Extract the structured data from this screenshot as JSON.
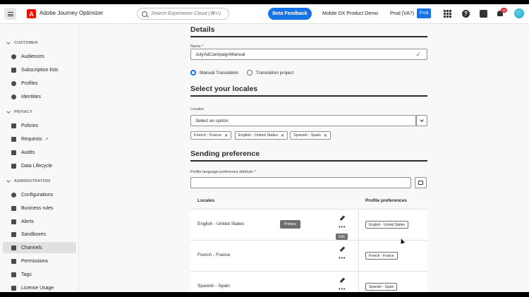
{
  "header": {
    "logo_letter": "A",
    "app_name": "Adobe Journey Optimizer",
    "search_placeholder": "Search Experience Cloud (⌘+/)",
    "beta_label": "Beta Feedback",
    "org_name": "Mobile DX Product Demo",
    "sandbox_name": "Prod (VA7)",
    "sandbox_badge": "Prod",
    "help_glyph": "?",
    "notification_count": "16",
    "icons": [
      "menu-icon",
      "apps-icon",
      "help-icon",
      "chat-icon",
      "bell-icon",
      "avatar"
    ],
    "accent_color": "#1473e6"
  },
  "sidebar": {
    "sections": [
      {
        "title": "CUSTOMER",
        "items": [
          {
            "label": "Audiences",
            "icon": "audiences-icon"
          },
          {
            "label": "Subscription lists",
            "icon": "subscription-lists-icon"
          },
          {
            "label": "Profiles",
            "icon": "profiles-icon"
          },
          {
            "label": "Identities",
            "icon": "identities-icon"
          }
        ]
      },
      {
        "title": "PRIVACY",
        "items": [
          {
            "label": "Policies",
            "icon": "policies-icon"
          },
          {
            "label": "Requests",
            "icon": "requests-icon",
            "ext": "↗"
          },
          {
            "label": "Audits",
            "icon": "audits-icon"
          },
          {
            "label": "Data Lifecycle",
            "icon": "data-lifecycle-icon"
          }
        ]
      },
      {
        "title": "ADMINISTRATION",
        "items": [
          {
            "label": "Configurations",
            "icon": "configurations-icon"
          },
          {
            "label": "Business rules",
            "icon": "business-rules-icon"
          },
          {
            "label": "Alerts",
            "icon": "alerts-icon"
          },
          {
            "label": "Sandboxes",
            "icon": "sandboxes-icon"
          },
          {
            "label": "Channels",
            "icon": "channels-icon",
            "selected": true
          },
          {
            "label": "Permissions",
            "icon": "permissions-icon"
          },
          {
            "label": "Tags",
            "icon": "tags-icon"
          },
          {
            "label": "License Usage",
            "icon": "license-usage-icon"
          }
        ]
      }
    ]
  },
  "details": {
    "title": "Details",
    "name_label": "Name",
    "required_mark": "*",
    "name_value": "JulyAdCampaignManual",
    "valid_glyph": "✓",
    "radio_manual": "Manual Translation",
    "radio_project": "Translation project",
    "selected_mode": "Manual Translation"
  },
  "locales": {
    "title": "Select your locales",
    "label": "Locales",
    "placeholder": "Select an option",
    "remove_glyph": "✕",
    "tags": [
      "French - France",
      "English - United States",
      "Spanish - Spain"
    ]
  },
  "sending": {
    "title": "Sending preference",
    "attr_label": "Profile language preference attribute",
    "attr_value": ""
  },
  "table": {
    "col_locales": "Locales",
    "col_prefs": "Profile preferences",
    "primary_label": "Primary",
    "more_glyph": "•••",
    "rows": [
      {
        "locale": "English - United States",
        "preference": "English - United States",
        "primary": true
      },
      {
        "locale": "French - France",
        "preference": "French - France",
        "primary": false
      },
      {
        "locale": "Spanish - Spain",
        "preference": "Spanish - Spain",
        "primary": false
      }
    ],
    "tooltip": "Edit"
  }
}
